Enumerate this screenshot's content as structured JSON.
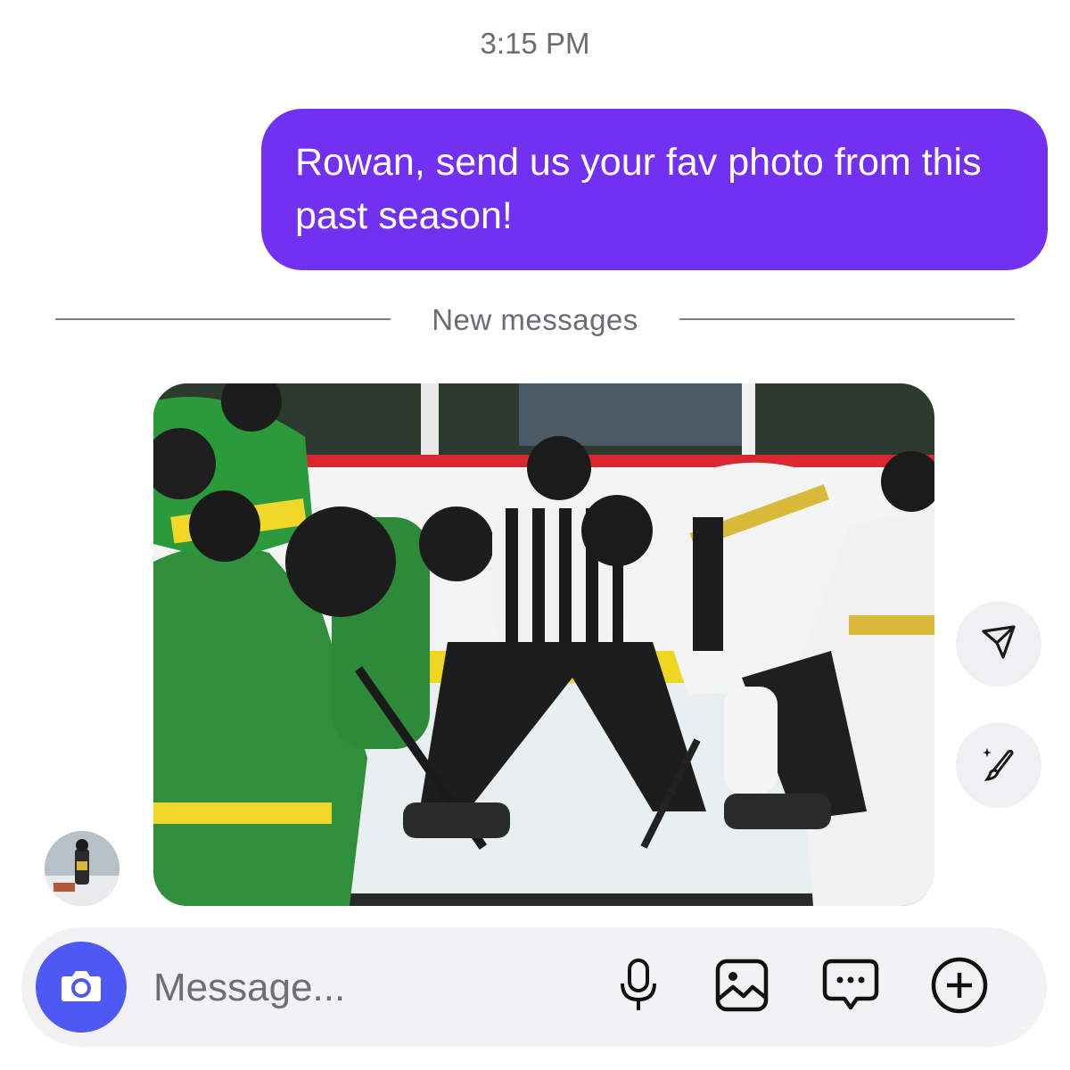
{
  "thread": {
    "timestamp": "3:15 PM",
    "outgoing_message": "Rowan, send us your fav photo from this past season!",
    "divider_label": "New messages"
  },
  "incoming": {
    "image": "hockey-faceoff-photo",
    "side_actions": [
      "send-icon",
      "edit-icon"
    ]
  },
  "composer": {
    "placeholder": "Message...",
    "icons": [
      "camera-icon",
      "microphone-icon",
      "gallery-icon",
      "sticker-chat-icon",
      "plus-icon"
    ]
  },
  "colors": {
    "bubble": "#7230f0",
    "camera_button": "#4e58f5",
    "composer_bg": "#f2f2f4"
  }
}
